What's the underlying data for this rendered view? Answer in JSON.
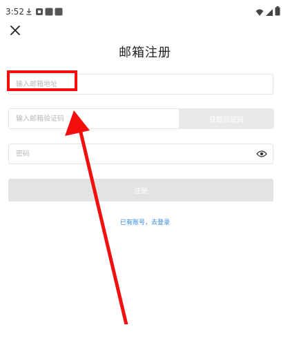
{
  "status_bar": {
    "time": "3:52"
  },
  "icons": {
    "close": "close-icon",
    "eye": "eye-icon",
    "download": "download-icon",
    "wifi": "wifi-icon",
    "signal": "signal-icon",
    "battery": "battery-icon"
  },
  "page": {
    "title": "邮箱注册"
  },
  "form": {
    "email_placeholder": "输入邮箱地址",
    "code_placeholder": "输入邮箱验证码",
    "get_code_label": "获取验证码",
    "password_placeholder": "密码",
    "register_label": "注册",
    "login_link": "已有账号，去登录"
  },
  "colors": {
    "accent": "#2f8ae5",
    "disabled_button": "#e3e3e6",
    "annotation": "#f40f0f"
  }
}
